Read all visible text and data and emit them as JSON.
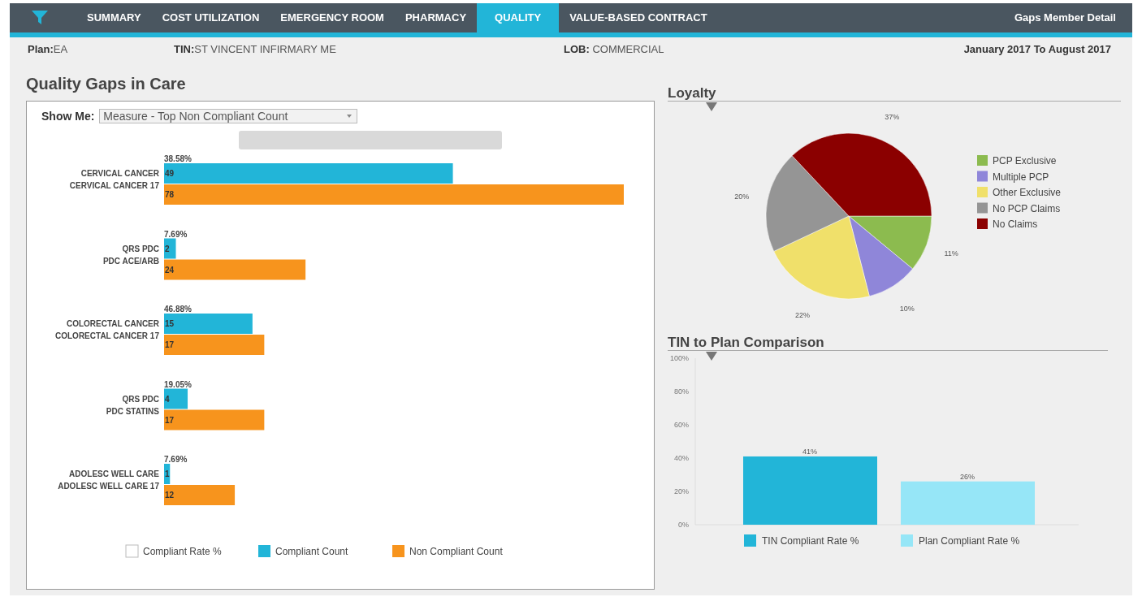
{
  "nav": {
    "tabs": [
      {
        "label": "SUMMARY",
        "selected": false
      },
      {
        "label": "COST UTILIZATION",
        "selected": false
      },
      {
        "label": "EMERGENCY ROOM",
        "selected": false
      },
      {
        "label": "PHARMACY",
        "selected": false
      },
      {
        "label": "QUALITY",
        "selected": true
      },
      {
        "label": "VALUE-BASED CONTRACT",
        "selected": false
      }
    ],
    "right_link": "Gaps Member Detail"
  },
  "info": {
    "plan_label": "Plan:",
    "plan": "EA",
    "tin_label": "TIN:",
    "tin": "ST VINCENT INFIRMARY ME",
    "lob_label": "LOB:",
    "lob": "COMMERCIAL",
    "date_range": "January 2017 To August 2017"
  },
  "quality": {
    "title": "Quality Gaps in Care",
    "show_me_label": "Show Me:",
    "show_me_value": "Measure - Top Non Compliant Count",
    "chart_data": {
      "type": "bar",
      "orientation": "horizontal",
      "categories": [
        "CERVICAL CANCER\nCERVICAL CANCER 17",
        "QRS PDC\nPDC ACE/ARB",
        "COLORECTAL CANCER\nCOLORECTAL CANCER 17",
        "QRS PDC\nPDC STATINS",
        "ADOLESC WELL CARE\nADOLESC WELL CARE 17"
      ],
      "series": [
        {
          "name": "Compliant Count",
          "color": "#22b5d8",
          "values": [
            49,
            2,
            15,
            4,
            1
          ]
        },
        {
          "name": "Non Compliant Count",
          "color": "#f7941d",
          "values": [
            78,
            24,
            17,
            17,
            12
          ]
        }
      ],
      "data_labels": true,
      "annotations": [
        {
          "text": "38.58%"
        },
        {
          "text": "7.69%"
        },
        {
          "text": "46.88%"
        },
        {
          "text": "19.05%"
        },
        {
          "text": "7.69%"
        }
      ],
      "legend": true
    },
    "rate_legend": {
      "name": "Compliant Rate %",
      "color": "#ffffff"
    }
  },
  "loyalty": {
    "title": "Loyalty",
    "chart_data": {
      "type": "pie",
      "categories": [
        "PCP Exclusive",
        "Multiple PCP",
        "Other Exclusive",
        "No PCP Claims",
        "No Claims"
      ],
      "series": [
        {
          "values": [
            11,
            10,
            22,
            20,
            37
          ]
        }
      ],
      "colors": [
        "#8cbb4f",
        "#8f86d9",
        "#f0e06a",
        "#959595",
        "#8b0000"
      ],
      "value_labels": [
        "11%",
        "10%",
        "22%",
        "20%",
        "37%"
      ],
      "legend": true
    }
  },
  "comparison": {
    "title": "TIN to Plan Comparison",
    "chart_data": {
      "type": "bar",
      "series": [
        {
          "name": "TIN Compliant Rate %",
          "color": "#22b5d8",
          "values": [
            41
          ],
          "value_labels": [
            "41%"
          ]
        },
        {
          "name": "Plan Compliant Rate %",
          "color": "#96e6f7",
          "values": [
            26
          ],
          "value_labels": [
            "26%"
          ]
        }
      ],
      "ylim": [
        0,
        100
      ],
      "yticks": [
        {
          "value": 0,
          "label": "0%"
        },
        {
          "value": 20,
          "label": "20%"
        },
        {
          "value": 40,
          "label": "40%"
        },
        {
          "value": 60,
          "label": "60%"
        },
        {
          "value": 80,
          "label": "80%"
        },
        {
          "value": 100,
          "label": "100%"
        }
      ],
      "legend": true
    }
  }
}
